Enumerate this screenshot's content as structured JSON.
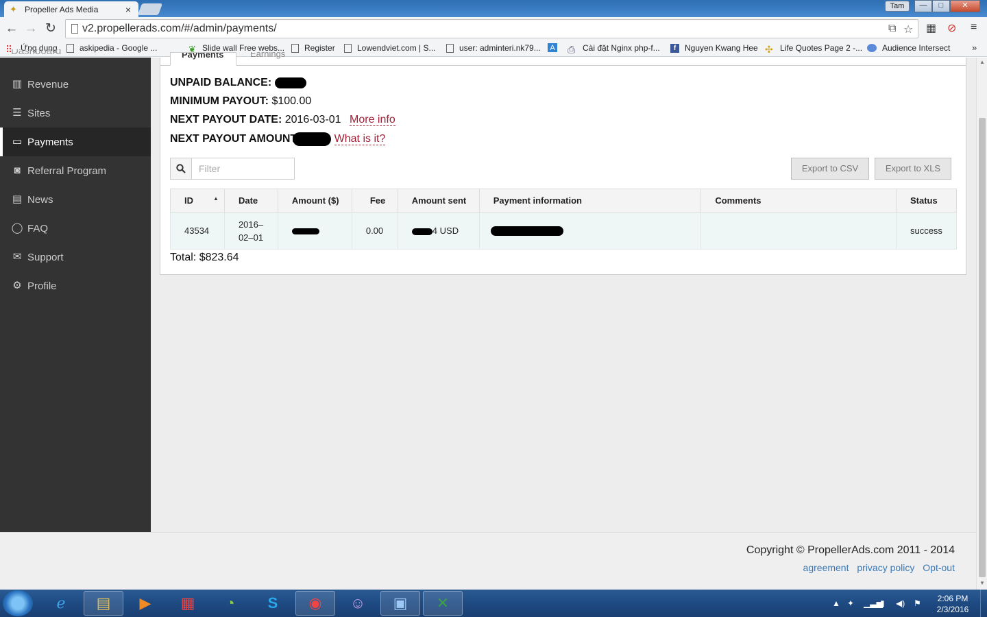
{
  "browser": {
    "tab_title": "Propeller Ads Media",
    "tab_close": "×",
    "user_badge": "Tam",
    "window_buttons": {
      "minimize": "—",
      "maximize": "□",
      "close": "✕"
    },
    "url": "v2.propellerads.com/#/admin/payments/",
    "bookmarks": [
      {
        "label": "Ứng dụng",
        "icon": "apps-grid-icon"
      },
      {
        "label": "askipedia - Google ...",
        "icon": "page-icon"
      },
      {
        "label": "Slide wall Free webs...",
        "icon": "leaf-icon"
      },
      {
        "label": "Register",
        "icon": "page-icon"
      },
      {
        "label": "Lowendviet.com | S...",
        "icon": "page-icon"
      },
      {
        "label": "user: adminteri.nk79...",
        "icon": "page-icon"
      },
      {
        "label": "",
        "icon": "a-letter-icon"
      },
      {
        "label": "Cài đặt Nginx php-f...",
        "icon": "printer-icon"
      },
      {
        "label": "Nguyen Kwang Hee",
        "icon": "facebook-icon"
      },
      {
        "label": "Life Quotes Page 2 -...",
        "icon": "pinwheel-icon"
      },
      {
        "label": "Audience Intersect",
        "icon": "cloud-icon"
      }
    ],
    "bookmarks_more": "»"
  },
  "sidebar": {
    "clipped_item": "Dashboard",
    "items": [
      {
        "label": "Revenue",
        "icon": "bar-chart-icon",
        "active": false
      },
      {
        "label": "Sites",
        "icon": "list-icon",
        "active": false
      },
      {
        "label": "Payments",
        "icon": "credit-card-icon",
        "active": true
      },
      {
        "label": "Referral Program",
        "icon": "money-icon",
        "active": false
      },
      {
        "label": "News",
        "icon": "newspaper-icon",
        "active": false
      },
      {
        "label": "FAQ",
        "icon": "chat-bubble-icon",
        "active": false
      },
      {
        "label": "Support",
        "icon": "envelope-icon",
        "active": false
      },
      {
        "label": "Profile",
        "icon": "gears-icon",
        "active": false
      }
    ]
  },
  "tabs": {
    "payments": "Payments",
    "earnings": "Earnings"
  },
  "summary": {
    "unpaid_balance_label": "UNPAID BALANCE:",
    "minimum_payout_label": "MINIMUM PAYOUT:",
    "minimum_payout_value": "$100.00",
    "next_payout_date_label": "NEXT PAYOUT DATE:",
    "next_payout_date_value": "2016-03-01",
    "more_info_link": "More info",
    "next_payout_amount_label": "NEXT PAYOUT AMOUNT:",
    "what_is_it_link": "What is it?"
  },
  "filter": {
    "placeholder": "Filter"
  },
  "export": {
    "csv": "Export to CSV",
    "xls": "Export to XLS"
  },
  "table": {
    "headers": [
      "ID",
      "Date",
      "Amount ($)",
      "Fee",
      "Amount sent",
      "Payment information",
      "Comments",
      "Status"
    ],
    "rows": [
      {
        "id": "43534",
        "date": "2016–02–01",
        "amount": "",
        "fee": "0.00",
        "amount_sent": "4 USD",
        "payment_info": "",
        "comments": "",
        "status": "success"
      }
    ]
  },
  "total": "Total: $823.64",
  "footer": {
    "copyright": "Copyright © PropellerAds.com 2011 - 2014",
    "links": [
      "agreement",
      "privacy policy",
      "Opt-out"
    ]
  },
  "taskbar": {
    "clock_time": "2:06 PM",
    "clock_date": "2/3/2016"
  }
}
